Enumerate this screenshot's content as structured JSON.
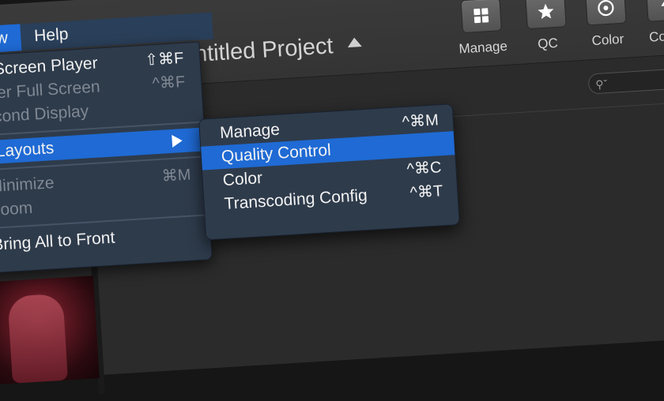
{
  "menubar": {
    "items": [
      {
        "label": "dow"
      },
      {
        "label": "Help"
      }
    ]
  },
  "window": {
    "title": "ntitled Project"
  },
  "toolbar": {
    "items": [
      {
        "label": "Manage",
        "icon": "grid-icon"
      },
      {
        "label": "QC",
        "icon": "star-icon"
      },
      {
        "label": "Color",
        "icon": "circle-icon"
      },
      {
        "label": "Config",
        "icon": "lightning-icon"
      }
    ]
  },
  "window_menu": {
    "items": [
      {
        "label": "ll Screen Player",
        "shortcut": "⇧⌘F",
        "enabled": true
      },
      {
        "label": "nter Full Screen",
        "shortcut": "^⌘F",
        "enabled": false
      },
      {
        "label": "econd Display",
        "shortcut": "",
        "enabled": false
      },
      {
        "label": "I Layouts",
        "shortcut": "",
        "enabled": true,
        "selected": true,
        "has_submenu": true
      },
      {
        "label": "Minimize",
        "shortcut": "⌘M",
        "enabled": false
      },
      {
        "label": "Zoom",
        "shortcut": "",
        "enabled": false
      },
      {
        "label": "Bring All to Front",
        "shortcut": "",
        "enabled": true
      }
    ]
  },
  "submenu": {
    "items": [
      {
        "label": "Manage",
        "shortcut": "^⌘M"
      },
      {
        "label": "Quality Control",
        "shortcut": "",
        "selected": true
      },
      {
        "label": "Color",
        "shortcut": "^⌘C"
      },
      {
        "label": "Transcoding Config",
        "shortcut": "^⌘T"
      }
    ]
  },
  "colors": {
    "accent": "#1f6ad4",
    "menu_bg": "#2e3b4b",
    "window_bg": "#2f2f2f"
  }
}
